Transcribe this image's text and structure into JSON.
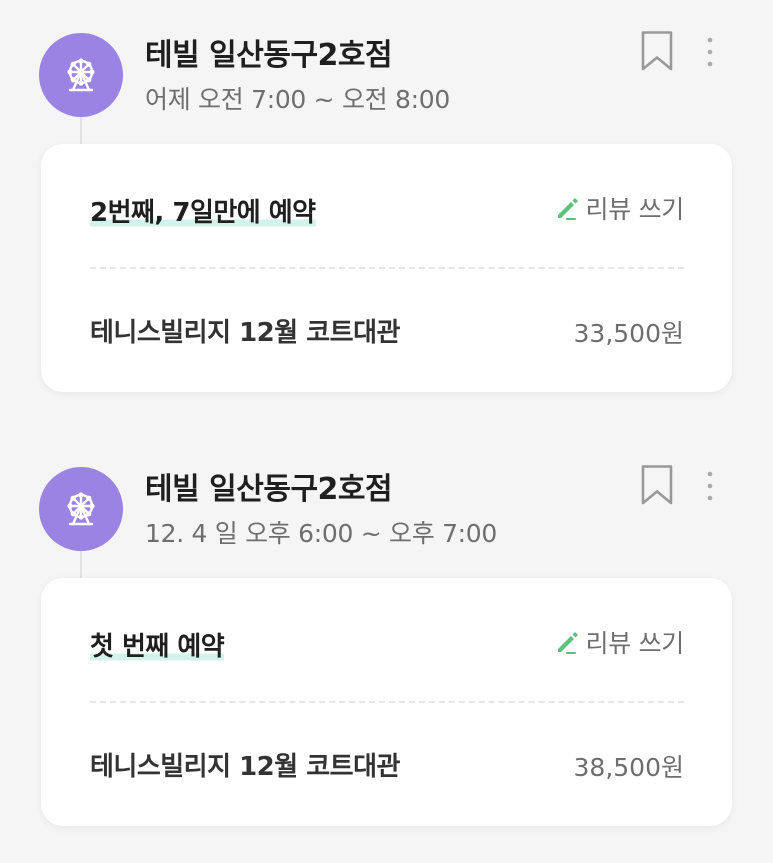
{
  "colors": {
    "avatar_bg": "#9a83e3",
    "highlight": "#d2f3ea",
    "pencil": "#5cc27a",
    "background": "#f5f5f5"
  },
  "icons": {
    "avatar": "ferris-wheel-icon",
    "bookmark": "bookmark-icon",
    "more": "more-vertical-icon",
    "review": "pencil-icon"
  },
  "reservations": [
    {
      "store_name": "테빌 일산동구2호점",
      "time": "어제 오전 7:00 ~ 오전 8:00",
      "visit_text": "2번째, 7일만에 예약",
      "review_label": "리뷰 쓰기",
      "item_name": "테니스빌리지 12월 코트대관",
      "item_price": "33,500원"
    },
    {
      "store_name": "테빌 일산동구2호점",
      "time": "12. 4 일 오후 6:00 ~ 오후 7:00",
      "visit_text": "첫 번째 예약",
      "review_label": "리뷰 쓰기",
      "item_name": "테니스빌리지 12월 코트대관",
      "item_price": "38,500원"
    }
  ]
}
